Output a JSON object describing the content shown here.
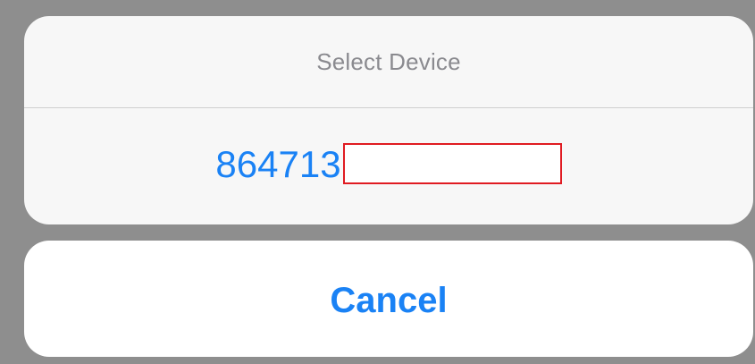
{
  "sheet": {
    "title": "Select Device",
    "options": [
      {
        "device_id": "864713"
      }
    ],
    "cancel_label": "Cancel"
  },
  "colors": {
    "background": "#8e8e8e",
    "sheet_background": "#f7f7f7",
    "cancel_background": "#ffffff",
    "title_text": "#8a8a8f",
    "accent_blue": "#1a82f5",
    "highlight_red": "#e01b22",
    "divider": "#cfcfcf"
  }
}
